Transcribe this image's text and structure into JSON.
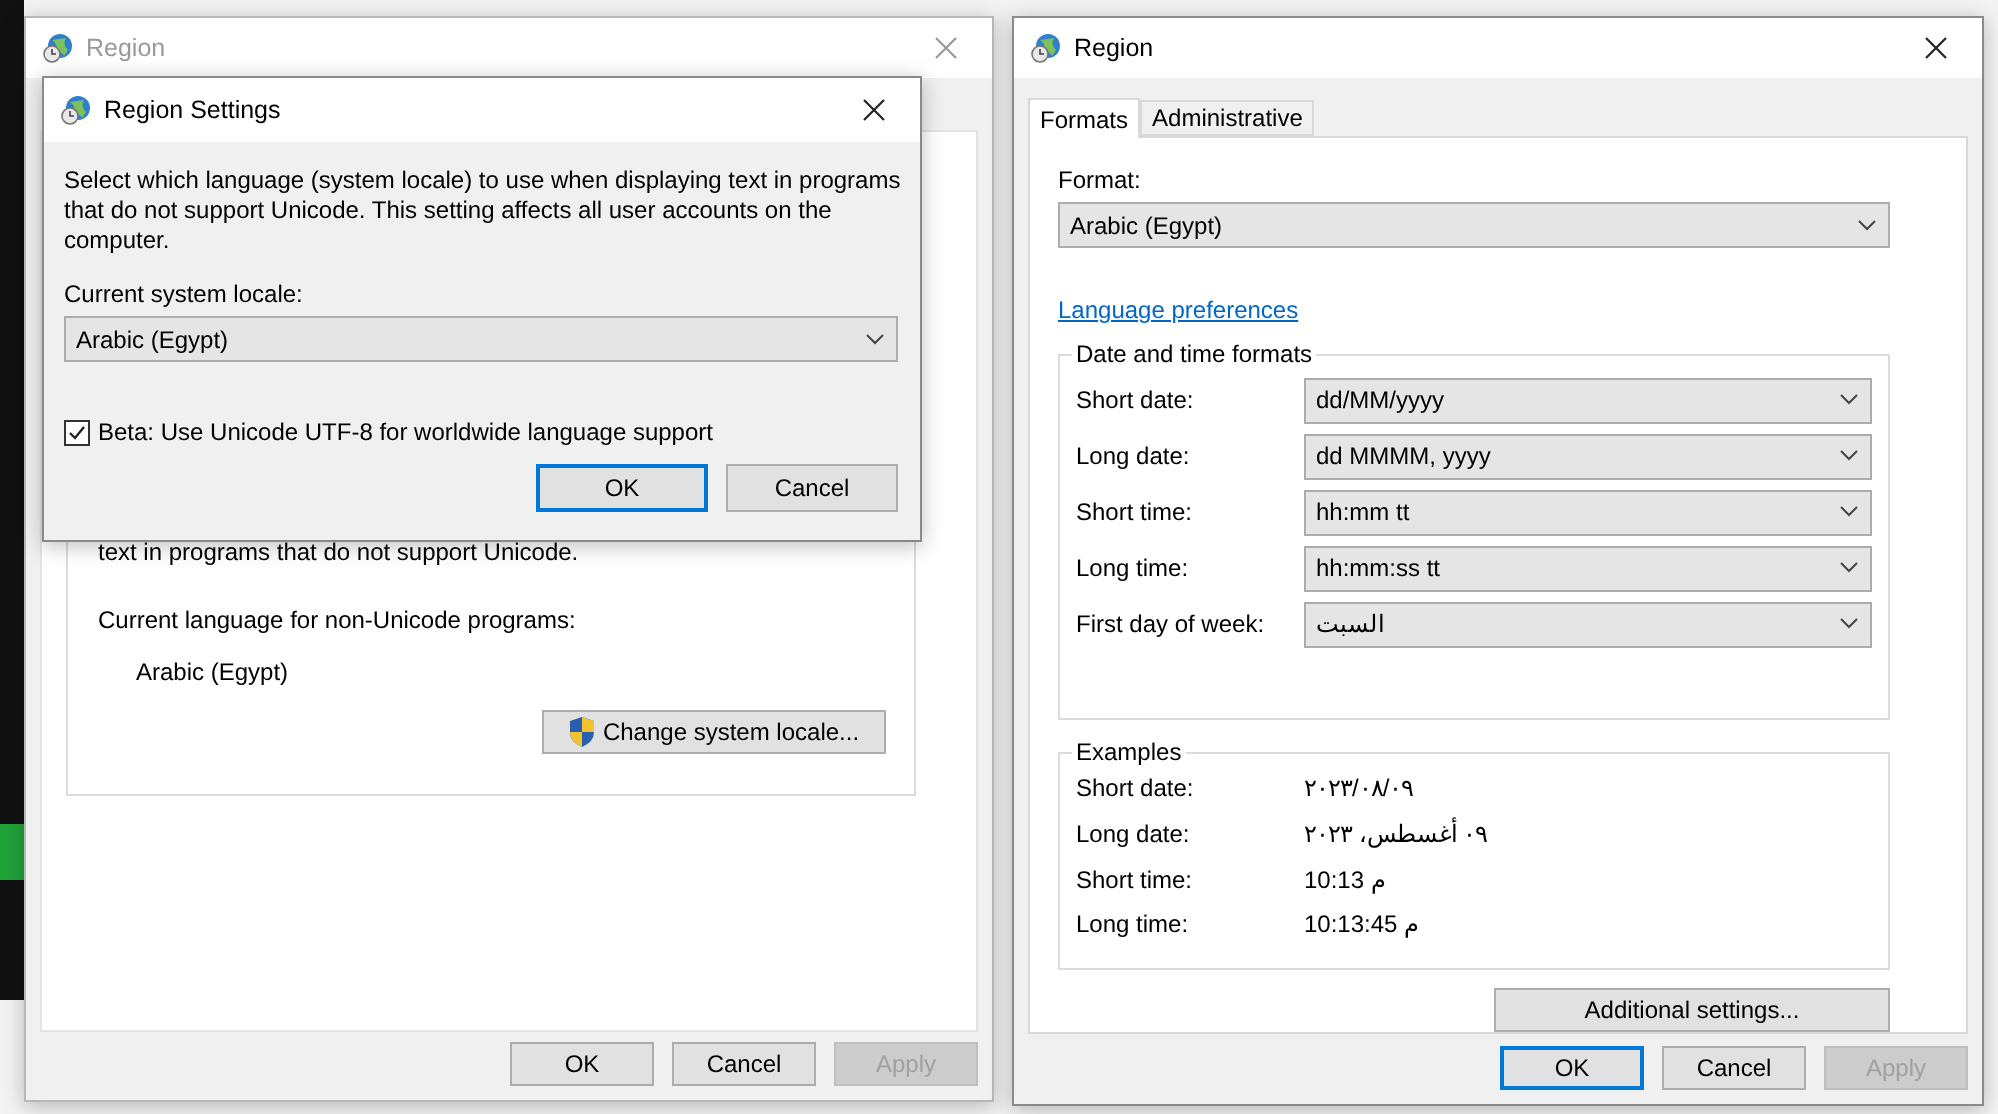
{
  "background_window": {
    "title": "Region",
    "active": false,
    "covered_text": "text in programs that do not support Unicode.",
    "language_label": "Current language for non-Unicode programs:",
    "language_value": "Arabic (Egypt)",
    "change_button": "Change system locale...",
    "buttons": [
      {
        "label": "OK",
        "default": false,
        "disabled": false
      },
      {
        "label": "Cancel",
        "default": false,
        "disabled": false
      },
      {
        "label": "Apply",
        "default": false,
        "disabled": true
      }
    ]
  },
  "locale_dialog": {
    "title": "Region Settings",
    "active": true,
    "description": "Select which language (system locale) to use when displaying text in programs that do not support Unicode. This setting affects all user accounts on the computer.",
    "locale_label": "Current system locale:",
    "locale_value": "Arabic (Egypt)",
    "utf8_option": {
      "label": "Beta: Use Unicode UTF-8 for worldwide language support",
      "checked": true
    },
    "buttons": [
      {
        "label": "OK",
        "default": true,
        "disabled": false
      },
      {
        "label": "Cancel",
        "default": false,
        "disabled": false
      }
    ]
  },
  "region_window": {
    "title": "Region",
    "active": true,
    "tabs": [
      {
        "label": "Formats",
        "selected": true
      },
      {
        "label": "Administrative",
        "selected": false
      }
    ],
    "format_label": "Format:",
    "format_value": "Arabic (Egypt)",
    "link": "Language preferences",
    "date_time_formats": {
      "title": "Date and time formats",
      "rows": [
        {
          "label": "Short date:",
          "value": "dd/MM/yyyy"
        },
        {
          "label": "Long date:",
          "value": "dd MMMM, yyyy"
        },
        {
          "label": "Short time:",
          "value": "hh:mm tt"
        },
        {
          "label": "Long time:",
          "value": "hh:mm:ss tt"
        },
        {
          "label": "First day of week:",
          "value": "السبت"
        }
      ]
    },
    "examples": {
      "title": "Examples",
      "rows": [
        {
          "label": "Short date:",
          "value": "٢٠٢٣/٠٨/٠٩"
        },
        {
          "label": "Long date:",
          "value": "٠٩ أغسطس، ٢٠٢٣"
        },
        {
          "label": "Short time:",
          "value": "10:13 م"
        },
        {
          "label": "Long time:",
          "value": "10:13:45 م"
        }
      ]
    },
    "additional_button": "Additional settings...",
    "buttons": [
      {
        "label": "OK",
        "default": true,
        "disabled": false
      },
      {
        "label": "Cancel",
        "default": false,
        "disabled": false
      },
      {
        "label": "Apply",
        "default": false,
        "disabled": true
      }
    ]
  }
}
